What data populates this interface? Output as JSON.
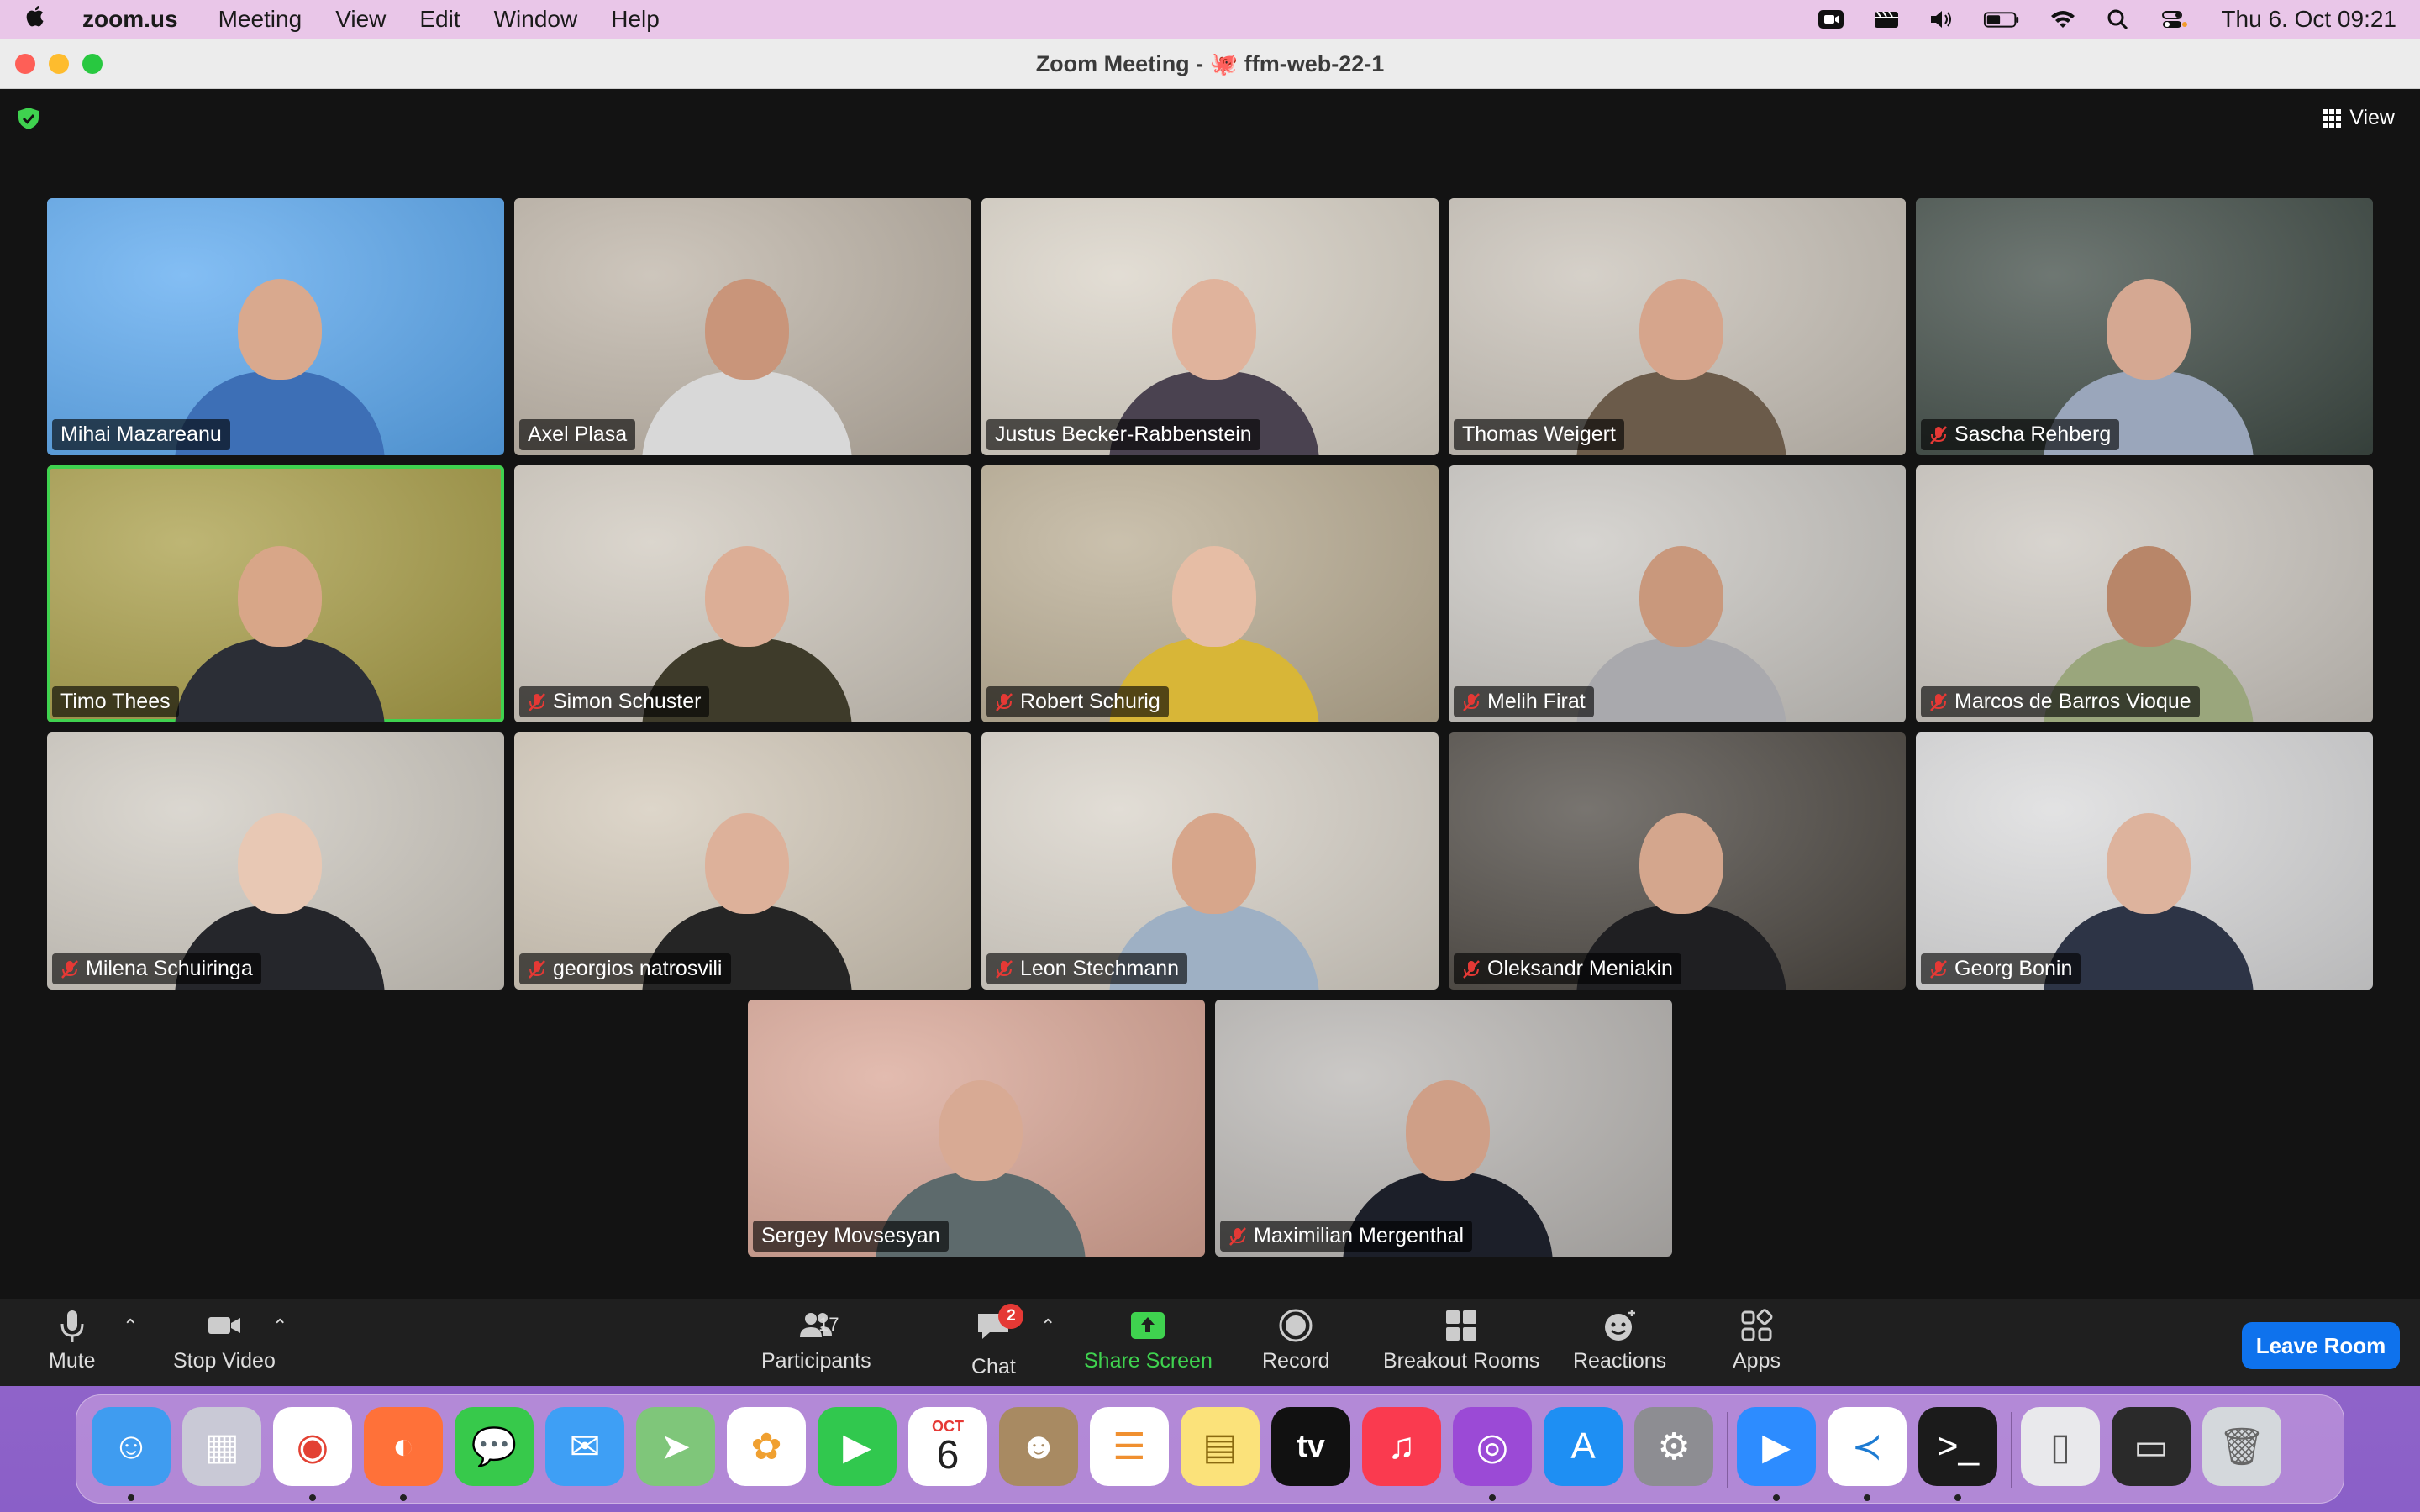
{
  "menubar": {
    "app_name": "zoom.us",
    "menus": [
      "Meeting",
      "View",
      "Edit",
      "Window",
      "Help"
    ],
    "clock": "Thu 6. Oct  09:21"
  },
  "window": {
    "title": "Zoom Meeting - 🐙 ffm-web-22-1",
    "view_label": "View"
  },
  "participants": [
    {
      "name": "Mihai Mazareanu",
      "muted": false,
      "bg": "#5aa8f0",
      "skin": "#d9a98e",
      "shirt": "#3d6fb6"
    },
    {
      "name": "Axel Plasa",
      "muted": false,
      "bg": "#bdb3a6",
      "skin": "#c9957a",
      "shirt": "#d8d8d8"
    },
    {
      "name": "Justus Becker-Rabbenstein",
      "muted": false,
      "bg": "#d9d2c6",
      "skin": "#e0b39c",
      "shirt": "#4a4250"
    },
    {
      "name": "Thomas Weigert",
      "muted": false,
      "bg": "#c8c1b7",
      "skin": "#d6a58c",
      "shirt": "#6b5b4a"
    },
    {
      "name": "Sascha Rehberg",
      "muted": true,
      "bg": "#3e4a44",
      "skin": "#d5a892",
      "shirt": "#9aa6bb"
    },
    {
      "name": "Timo Thees",
      "muted": false,
      "bg": "#a89d46",
      "skin": "#d8a688",
      "shirt": "#2b2e36"
    },
    {
      "name": "Simon Schuster",
      "muted": true,
      "bg": "#cfc8bd",
      "skin": "#dcae96",
      "shirt": "#3e3b2a"
    },
    {
      "name": "Robert Schurig",
      "muted": true,
      "bg": "#b9ac92",
      "skin": "#e6bda5",
      "shirt": "#d8b637"
    },
    {
      "name": "Melih Firat",
      "muted": true,
      "bg": "#c9c6c1",
      "skin": "#c9987c",
      "shirt": "#a9a9ad"
    },
    {
      "name": "Marcos de Barros Vioque",
      "muted": true,
      "bg": "#cbc6bf",
      "skin": "#b88669",
      "shirt": "#9aa67c"
    },
    {
      "name": "Milena Schuiringa",
      "muted": true,
      "bg": "#cfcac1",
      "skin": "#e8c8b4",
      "shirt": "#25262b"
    },
    {
      "name": "georgios natrosvili",
      "muted": true,
      "bg": "#d2c8b8",
      "skin": "#ddb19a",
      "shirt": "#252525"
    },
    {
      "name": "Leon Stechmann",
      "muted": true,
      "bg": "#d8d2c8",
      "skin": "#d7a68b",
      "shirt": "#9eb0c4"
    },
    {
      "name": "Oleksandr Meniakin",
      "muted": true,
      "bg": "#4b4640",
      "skin": "#d4a68d",
      "shirt": "#1f1f22"
    },
    {
      "name": "Georg Bonin",
      "muted": true,
      "bg": "#d9d9da",
      "skin": "#ddb39d",
      "shirt": "#2d3446"
    },
    {
      "name": "Sergey Movsesyan",
      "muted": false,
      "bg": "#d9a595",
      "skin": "#d8aa94",
      "shirt": "#5d6a6c"
    },
    {
      "name": "Maximilian Mergenthal",
      "muted": true,
      "bg": "#b9b6b3",
      "skin": "#cf9f87",
      "shirt": "#1c1f29"
    }
  ],
  "toolbar": {
    "mute": "Mute",
    "stop_video": "Stop Video",
    "participants": "Participants",
    "participant_count": "17",
    "chat": "Chat",
    "chat_badge": "2",
    "share_screen": "Share Screen",
    "record": "Record",
    "breakout_rooms": "Breakout Rooms",
    "reactions": "Reactions",
    "apps": "Apps",
    "leave_room": "Leave Room"
  },
  "dock": {
    "calendar_month": "OCT",
    "calendar_day": "6",
    "tv_label": "tv",
    "apps": [
      {
        "name": "finder-icon",
        "color": "#3f9cf0"
      },
      {
        "name": "launchpad-icon",
        "color": "#c9c9d6"
      },
      {
        "name": "chrome-icon",
        "color": "#ffffff"
      },
      {
        "name": "firefox-icon",
        "color": "#ff7139"
      },
      {
        "name": "messages-icon",
        "color": "#37c94b"
      },
      {
        "name": "mail-icon",
        "color": "#3e9ff5"
      },
      {
        "name": "maps-icon",
        "color": "#7fc67a"
      },
      {
        "name": "photos-icon",
        "color": "#ffffff"
      },
      {
        "name": "facetime-icon",
        "color": "#31c84e"
      },
      {
        "name": "calendar-icon",
        "color": "#ffffff"
      },
      {
        "name": "contacts-icon",
        "color": "#a88a62"
      },
      {
        "name": "reminders-icon",
        "color": "#ffffff"
      },
      {
        "name": "notes-icon",
        "color": "#fbe27a"
      },
      {
        "name": "apple-tv-icon",
        "color": "#111111"
      },
      {
        "name": "music-icon",
        "color": "#fa3a4f"
      },
      {
        "name": "podcasts-icon",
        "color": "#9b4ad6"
      },
      {
        "name": "app-store-icon",
        "color": "#1e8ff3"
      },
      {
        "name": "system-preferences-icon",
        "color": "#8d8d92"
      },
      {
        "name": "zoom-icon",
        "color": "#2d8cff"
      },
      {
        "name": "vscode-icon",
        "color": "#ffffff"
      },
      {
        "name": "terminal-icon",
        "color": "#1b1b1b"
      },
      {
        "name": "archive-icon",
        "color": "#e9e9ec"
      },
      {
        "name": "screenshot-icon",
        "color": "#2a2a2a"
      },
      {
        "name": "trash-icon",
        "color": "#d4d8dc"
      }
    ]
  }
}
